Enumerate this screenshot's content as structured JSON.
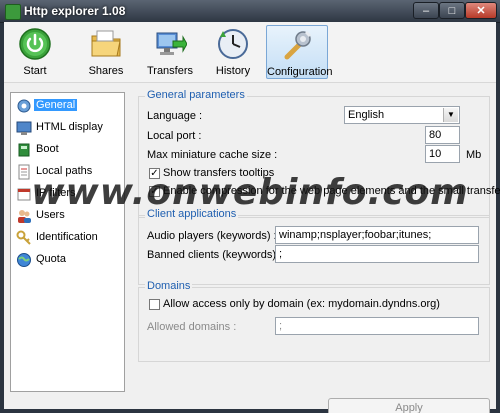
{
  "window": {
    "title": "Http explorer 1.08",
    "min": "–",
    "max": "□",
    "close": "✕"
  },
  "toolbar": {
    "items": [
      {
        "label": "Start",
        "icon": "power-icon"
      },
      {
        "label": "Shares",
        "icon": "folder-icon"
      },
      {
        "label": "Transfers",
        "icon": "transfers-icon"
      },
      {
        "label": "History",
        "icon": "history-clock-icon"
      },
      {
        "label": "Configuration",
        "icon": "wrench-icon",
        "selected": true
      }
    ]
  },
  "sidebar": {
    "items": [
      {
        "label": "General",
        "icon": "gear-icon",
        "active": true
      },
      {
        "label": "HTML display",
        "icon": "monitor-icon"
      },
      {
        "label": "Boot",
        "icon": "boot-icon"
      },
      {
        "label": "Local paths",
        "icon": "document-icon"
      },
      {
        "label": "IP filters",
        "icon": "filter-icon"
      },
      {
        "label": "Users",
        "icon": "users-icon"
      },
      {
        "label": "Identification",
        "icon": "key-icon"
      },
      {
        "label": "Quota",
        "icon": "globe-icon"
      }
    ]
  },
  "general": {
    "title": "General parameters",
    "language_label": "Language :",
    "language_value": "English",
    "port_label": "Local port :",
    "port_value": "80",
    "cache_label": "Max miniature cache size :",
    "cache_value": "10",
    "cache_unit": "Mb",
    "tooltips_label": "Show transfers tooltips",
    "tooltips_checked": true,
    "compression_label": "Enable compression for the web page elements and the small transfers",
    "compression_checked": true
  },
  "clients": {
    "title": "Client applications",
    "audio_label": "Audio players (keywords) :",
    "audio_value": "winamp;nsplayer;foobar;itunes;",
    "banned_label": "Banned clients (keywords) :",
    "banned_value": ";"
  },
  "domains": {
    "title": "Domains",
    "allow_label": "Allow access only by domain (ex: mydomain.dyndns.org)",
    "allow_checked": false,
    "allowed_label": "Allowed domains :",
    "allowed_value": ";"
  },
  "apply_label": "Apply",
  "watermark": "www.onwebinfo.com"
}
